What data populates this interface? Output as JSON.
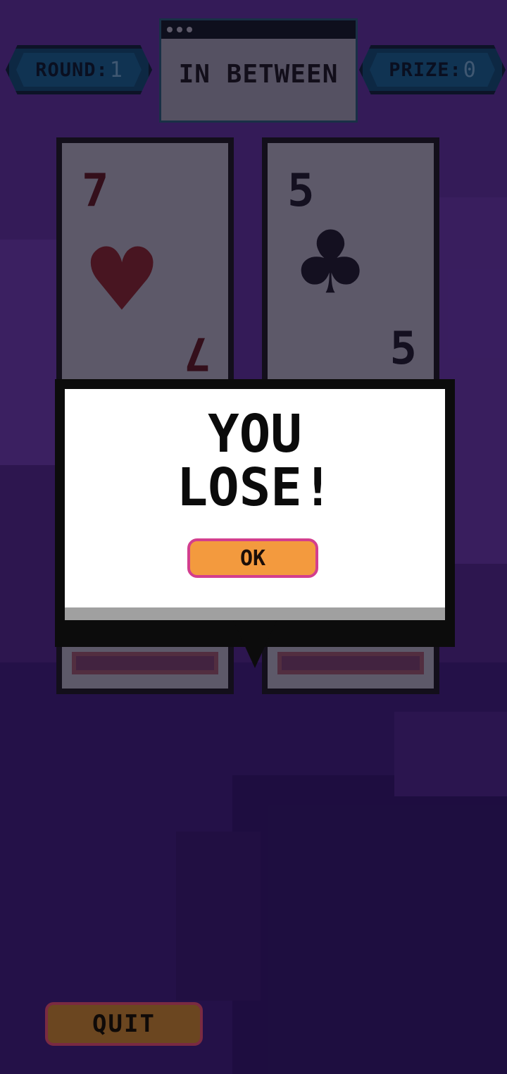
{
  "hud": {
    "round_label": "ROUND:",
    "round_value": "1",
    "prize_label": "PRIZE:",
    "prize_value": "0"
  },
  "title": "IN BETWEEN",
  "cards": [
    {
      "rank": "7",
      "suit_glyph": "♥",
      "suit_name": "hearts",
      "color": "#6a1d1d"
    },
    {
      "rank": "5",
      "suit_glyph": "♣",
      "suit_name": "clubs",
      "color": "#15151c"
    }
  ],
  "dialog": {
    "message_line1": "YOU",
    "message_line2": "LOSE!",
    "ok_label": "OK"
  },
  "quit_label": "QUIT",
  "colors": {
    "background": "#3e2068",
    "hud_pill": "#0f4e6c",
    "ok_button": "#f39a3e",
    "quit_button": "#6b4620"
  }
}
